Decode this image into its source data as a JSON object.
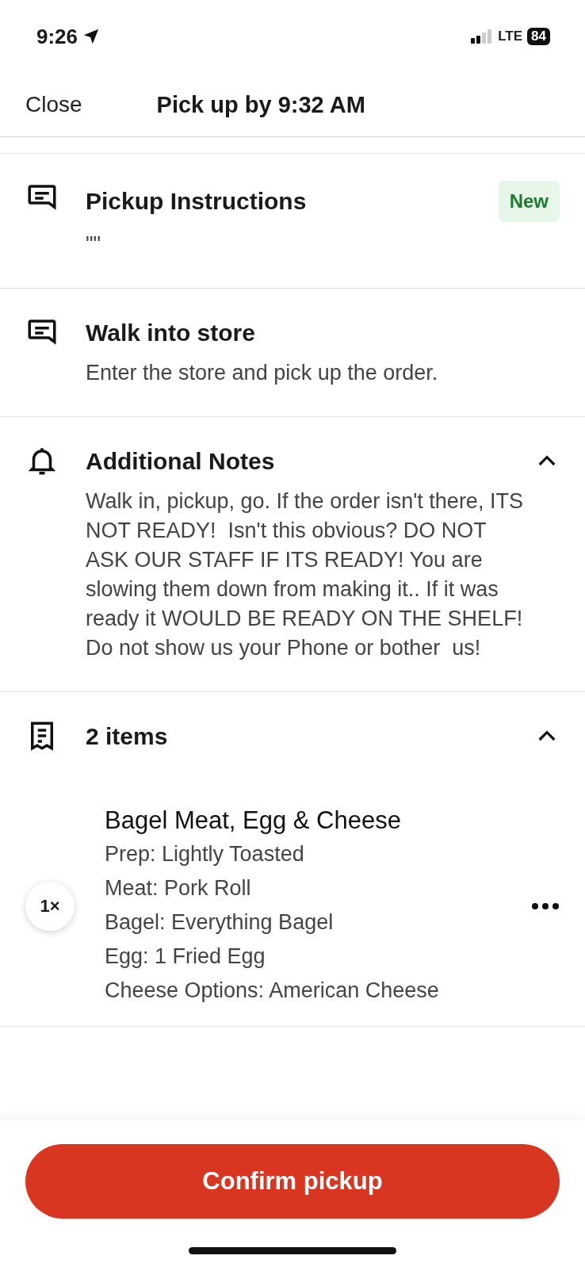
{
  "status_bar": {
    "time": "9:26",
    "network": "LTE",
    "battery": "84"
  },
  "header": {
    "close": "Close",
    "title": "Pick up by 9:32 AM"
  },
  "sections": [
    {
      "kind": "message",
      "title": "Pickup Instructions",
      "body": "\"\"",
      "badge": "New"
    },
    {
      "kind": "message",
      "title": "Walk into store",
      "body": "Enter the store and pick up the order."
    },
    {
      "kind": "notes",
      "title": "Additional Notes",
      "expanded": true,
      "body": "Walk in, pickup, go. If the order isn't there, ITS NOT READY!  Isn't this obvious? DO NOT ASK OUR STAFF IF ITS READY! You are slowing them down from making it.. If it was ready it WOULD BE READY ON THE SHELF! Do not show us your Phone or bother  us!"
    },
    {
      "kind": "items",
      "title": "2 items",
      "expanded": true
    }
  ],
  "items": [
    {
      "quantity": "1×",
      "name": "Bagel Meat, Egg & Cheese",
      "options": [
        "Prep: Lightly Toasted",
        "Meat: Pork Roll",
        "Bagel: Everything Bagel",
        "Egg: 1 Fried Egg",
        "Cheese Options: American Cheese"
      ]
    }
  ],
  "confirm_button": "Confirm pickup"
}
